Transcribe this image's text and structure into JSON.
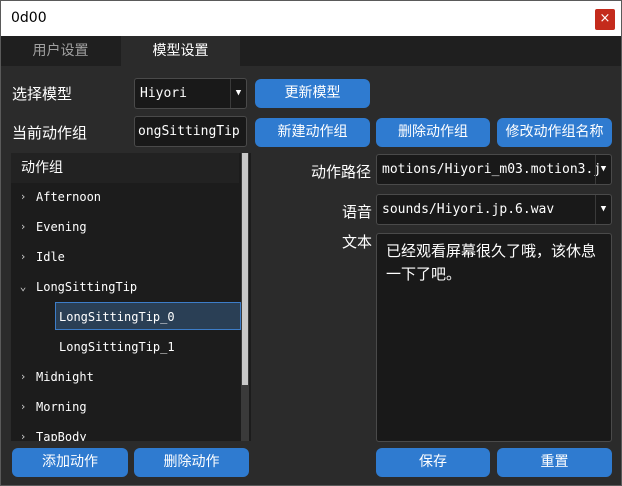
{
  "window": {
    "title": "0d00",
    "close_glyph": "×"
  },
  "tabs": [
    {
      "label": "用户设置"
    },
    {
      "label": "模型设置"
    }
  ],
  "model": {
    "label": "选择模型",
    "selected": "Hiyori",
    "update_button": "更新模型"
  },
  "group": {
    "label": "当前动作组",
    "value": "ongSittingTip",
    "new_button": "新建动作组",
    "delete_button": "删除动作组",
    "rename_button": "修改动作组名称"
  },
  "tree": {
    "header": "动作组",
    "items": [
      {
        "label": "Afternoon",
        "expander": "›"
      },
      {
        "label": "Evening",
        "expander": "›"
      },
      {
        "label": "Idle",
        "expander": "›"
      },
      {
        "label": "LongSittingTip",
        "expander": "⌄"
      },
      {
        "label": "LongSittingTip_0",
        "expander": ""
      },
      {
        "label": "LongSittingTip_1",
        "expander": ""
      },
      {
        "label": "Midnight",
        "expander": "›"
      },
      {
        "label": "Morning",
        "expander": "›"
      },
      {
        "label": "TapBody",
        "expander": "›"
      }
    ],
    "selected_index": 4
  },
  "detail": {
    "path_label": "动作路径",
    "path_value": "motions/Hiyori_m03.motion3.j",
    "voice_label": "语音",
    "voice_value": "sounds/Hiyori.jp.6.wav",
    "text_label": "文本",
    "text_value": "已经观看屏幕很久了哦，该休息一下了吧。"
  },
  "buttons": {
    "add_motion": "添加动作",
    "delete_motion": "删除动作",
    "save": "保存",
    "reset": "重置"
  },
  "dropdown_glyph": "▼",
  "colors": {
    "accent": "#2f7bd0",
    "close": "#c42b1c",
    "background": "#2b2b2b"
  }
}
